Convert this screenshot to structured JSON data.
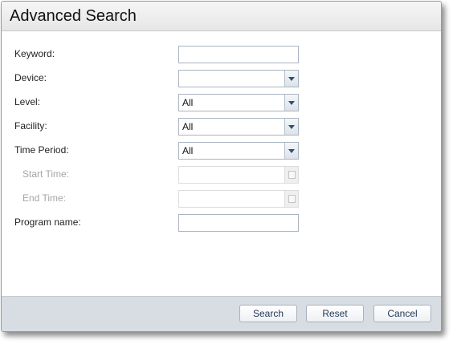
{
  "dialog": {
    "title": "Advanced Search"
  },
  "form": {
    "keyword": {
      "label": "Keyword:",
      "value": ""
    },
    "device": {
      "label": "Device:",
      "value": ""
    },
    "level": {
      "label": "Level:",
      "value": "All"
    },
    "facility": {
      "label": "Facility:",
      "value": "All"
    },
    "time_period": {
      "label": "Time Period:",
      "value": "All"
    },
    "start_time": {
      "label": "Start Time:",
      "value": "",
      "enabled": false
    },
    "end_time": {
      "label": "End Time:",
      "value": "",
      "enabled": false
    },
    "program_name": {
      "label": "Program name:",
      "value": ""
    }
  },
  "buttons": {
    "search": "Search",
    "reset": "Reset",
    "cancel": "Cancel"
  },
  "icons": {
    "dropdown": "chevron-down-icon",
    "calendar": "calendar-icon"
  },
  "colors": {
    "footer_bg": "#d8dde3",
    "dropdown_arrow": "#2d4f7a",
    "disabled_label": "#a6a6a6"
  }
}
